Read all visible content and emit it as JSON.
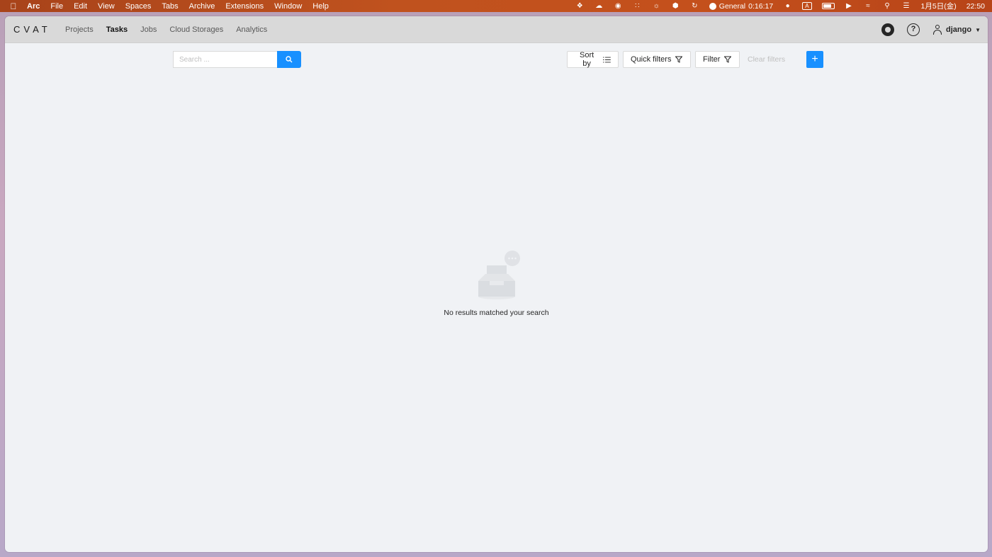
{
  "menubar": {
    "apple": "",
    "items": [
      "Arc",
      "File",
      "Edit",
      "View",
      "Spaces",
      "Tabs",
      "Archive",
      "Extensions",
      "Window",
      "Help"
    ],
    "status": {
      "timer_label": "General",
      "timer_value": "0:16:17",
      "keyboard": "A",
      "date": "1月5日(金)",
      "time": "22:50"
    }
  },
  "app": {
    "logo": "CVAT",
    "nav": [
      {
        "label": "Projects",
        "active": false
      },
      {
        "label": "Tasks",
        "active": true
      },
      {
        "label": "Jobs",
        "active": false
      },
      {
        "label": "Cloud Storages",
        "active": false
      },
      {
        "label": "Analytics",
        "active": false
      }
    ],
    "user": "django"
  },
  "toolbar": {
    "search_placeholder": "Search ...",
    "sort_label": "Sort by",
    "quick_filters_label": "Quick filters",
    "filter_label": "Filter",
    "clear_filters_label": "Clear filters",
    "add_label": "+"
  },
  "empty_state": {
    "message": "No results matched your search"
  },
  "colors": {
    "primary": "#1890ff",
    "menubar": "#c0521e",
    "background": "#f0f2f5"
  }
}
